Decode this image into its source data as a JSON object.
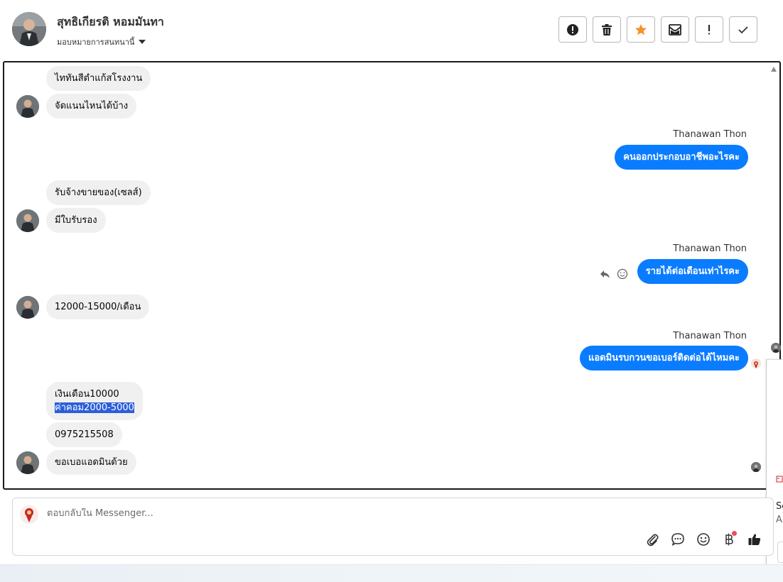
{
  "header": {
    "contact_name": "สุทธิเกียรติ หอมมันทา",
    "assign_label": "มอบหมายการสนทนานี้",
    "actions": [
      {
        "icon": "alert-circle-icon",
        "name": "spam-button"
      },
      {
        "icon": "trash-icon",
        "name": "delete-button"
      },
      {
        "icon": "star-icon",
        "name": "star-button"
      },
      {
        "icon": "mark-unread-icon",
        "name": "mark-unread-button"
      },
      {
        "icon": "exclamation-icon",
        "name": "important-button"
      },
      {
        "icon": "check-icon",
        "name": "done-button"
      }
    ]
  },
  "messages": {
    "m1": "ไททันสีตำแก้สโรงงาน",
    "m2": "จัดแนนไหนได้บ้าง",
    "sender1": "Thanawan Thon",
    "m3": "คนออกประกอบอาชีพอะไรคะ",
    "m4": "รับจ้างขายของ(เซลส์)",
    "m5": "มีใบรับรอง",
    "sender2": "Thanawan Thon",
    "m6": "รายได้ต่อเดือนเท่าไรคะ",
    "m7": "12000-15000/เดือน",
    "sender3": "Thanawan Thon",
    "m8": "แอดมินรบกวนขอเบอร์ติดต่อได้ไหมคะ",
    "m9_line1": "เงินเดือน10000",
    "m9_line2": "ค่าคอม2000-5000",
    "m10": "0975215508",
    "m11": "ขอเบอแอดมินด้วย"
  },
  "composer": {
    "placeholder": "ตอบกลับใน Messenger...",
    "icons": [
      "paperclip-icon",
      "chat-bubble-icon",
      "smiley-icon",
      "baht-icon",
      "thumbs-up-icon"
    ]
  },
  "side_panel": {
    "text1": "Se",
    "text2": "A"
  },
  "colors": {
    "outgoing_bubble": "#0a7cff",
    "incoming_bubble": "#f0f0f0",
    "star": "#f6922b",
    "notification_dot": "#ee4b5c"
  }
}
